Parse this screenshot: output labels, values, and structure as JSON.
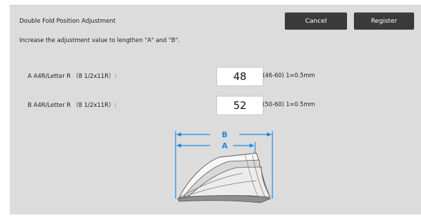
{
  "header": {
    "title": "Double Fold Position Adjustment",
    "cancel_label": "Cancel",
    "register_label": "Register"
  },
  "instruction": "Increase the adjustment value to lengthen \"A\" and \"B\".",
  "rows": [
    {
      "label": "A A4R/Letter R （8 1/2x11R）:",
      "value": "48",
      "range": "(46-60) 1=0.5mm"
    },
    {
      "label": "B A4R/Letter R （8 1/2x11R）:",
      "value": "52",
      "range": "(50-60) 1=0.5mm"
    }
  ],
  "diagram": {
    "label_b": "B",
    "label_a": "A",
    "accent_color": "#1e88e5"
  }
}
